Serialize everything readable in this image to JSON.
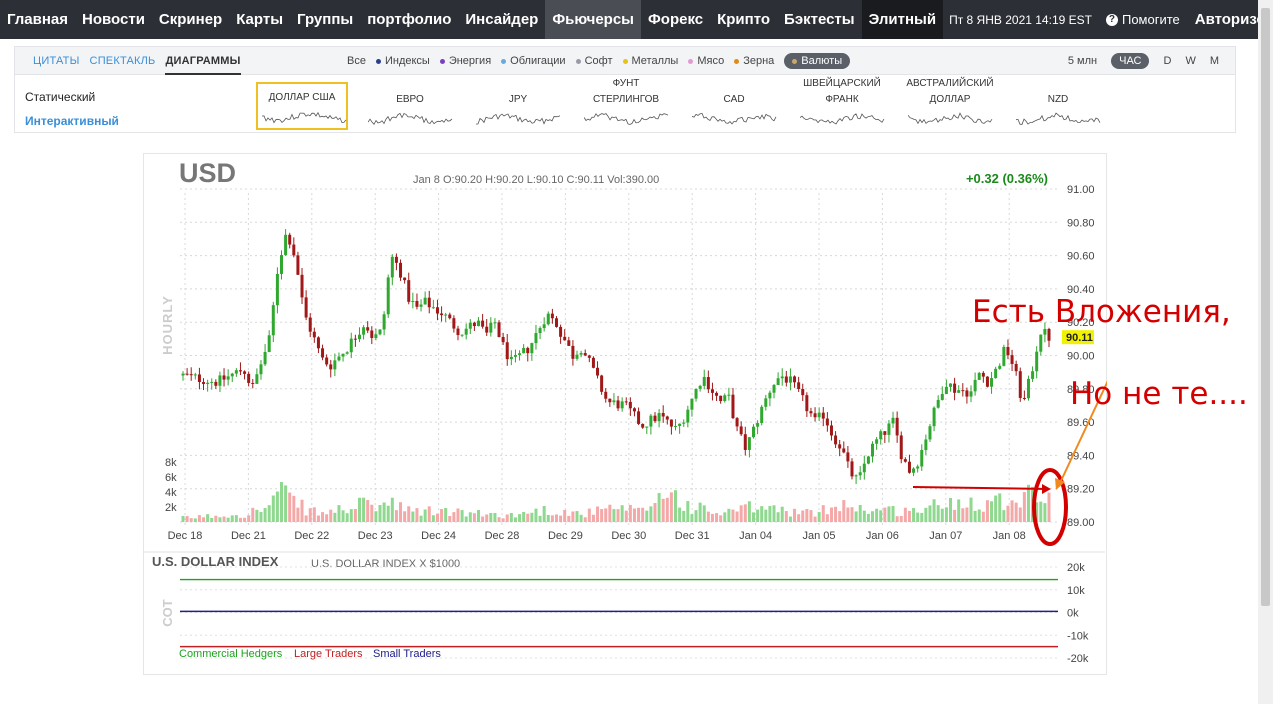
{
  "nav": {
    "items": [
      {
        "label": "Главная",
        "name": "nav-home"
      },
      {
        "label": "Новости",
        "name": "nav-news"
      },
      {
        "label": "Скринер",
        "name": "nav-screener"
      },
      {
        "label": "Карты",
        "name": "nav-maps"
      },
      {
        "label": "Группы",
        "name": "nav-groups"
      },
      {
        "label": "портфолио",
        "name": "nav-portfolio"
      },
      {
        "label": "Инсайдер",
        "name": "nav-insider"
      },
      {
        "label": "Фьючерсы",
        "name": "nav-futures"
      },
      {
        "label": "Форекс",
        "name": "nav-forex"
      },
      {
        "label": "Крипто",
        "name": "nav-crypto"
      },
      {
        "label": "Бэктесты",
        "name": "nav-backtests"
      },
      {
        "label": "Элитный",
        "name": "nav-elite"
      }
    ],
    "date": "Пт 8 ЯНВ 2021 14:19 EST",
    "help": "Помогите",
    "auth": "Авторизовать"
  },
  "panel": {
    "tabs": [
      "ЦИТАТЫ",
      "СПЕКТАКЛЬ",
      "ДИАГРАММЫ"
    ],
    "categories": [
      {
        "label": "Все",
        "dot": ""
      },
      {
        "label": "Индексы",
        "dot": "#2b3f8c"
      },
      {
        "label": "Энергия",
        "dot": "#7a3fc2"
      },
      {
        "label": "Облигации",
        "dot": "#6aa9e0"
      },
      {
        "label": "Софт",
        "dot": "#9a9aa8"
      },
      {
        "label": "Металлы",
        "dot": "#e6c21a"
      },
      {
        "label": "Мясо",
        "dot": "#e29ad0"
      },
      {
        "label": "Зерна",
        "dot": "#e08a1a"
      },
      {
        "label": "Валюты",
        "dot": "#9a7a3a"
      }
    ],
    "timeframes": [
      "5 млн",
      "ЧАС",
      "D",
      "W",
      "M"
    ],
    "links": {
      "static": "Статический",
      "interactive": "Интерактивный"
    },
    "thumbnails": [
      "ДОЛЛАР США",
      "ЕВРО",
      "JPY",
      "ФУНТ СТЕРЛИНГОВ",
      "CAD",
      "ШВЕЙЦАРСКИЙ ФРАНК",
      "АВСТРАЛИЙСКИЙ ДОЛЛАР",
      "NZD"
    ]
  },
  "chart": {
    "symbol": "USD",
    "ohlc": "Jan 8     O:90.20  H:90.20  L:90.10  C:90.11        Vol:390.00",
    "change": "+0.32 (0.36%)",
    "side_label": "HOURLY",
    "last_price": "90.11",
    "cot_title": "U.S. DOLLAR INDEX",
    "cot_subtitle": "U.S. DOLLAR INDEX X $1000",
    "cot_side_label": "COT",
    "legend": [
      "Commercial Hedgers",
      "Large Traders",
      "Small Traders"
    ]
  },
  "chart_data": {
    "type": "candlestick",
    "title": "USD",
    "timeframe": "hourly",
    "x_ticks": [
      "Dec 18",
      "Dec 21",
      "Dec 22",
      "Dec 23",
      "Dec 24",
      "Dec 28",
      "Dec 29",
      "Dec 30",
      "Dec 31",
      "Jan 04",
      "Jan 05",
      "Jan 06",
      "Jan 07",
      "Jan 08"
    ],
    "y_ticks": [
      "91.00",
      "90.80",
      "90.60",
      "90.40",
      "90.20",
      "90.00",
      "89.80",
      "89.60",
      "89.40",
      "89.20",
      "89.00"
    ],
    "ylim": [
      89.0,
      91.0
    ],
    "volume_ticks": [
      "8k",
      "6k",
      "4k",
      "2k"
    ],
    "last_ohlc": {
      "date": "Jan 8",
      "open": 90.2,
      "high": 90.2,
      "low": 90.1,
      "close": 90.11,
      "volume": 390.0
    },
    "change": "+0.32 (0.36%)",
    "price_path": [
      [
        0,
        89.88
      ],
      [
        4,
        89.84
      ],
      [
        7,
        89.92
      ],
      [
        8,
        89.8
      ],
      [
        10,
        90.1
      ],
      [
        11,
        90.55
      ],
      [
        12,
        90.75
      ],
      [
        13,
        90.58
      ],
      [
        14,
        90.25
      ],
      [
        15,
        90.12
      ],
      [
        16,
        89.98
      ],
      [
        17,
        89.94
      ],
      [
        19,
        90.05
      ],
      [
        21,
        90.2
      ],
      [
        22,
        90.1
      ],
      [
        23,
        90.15
      ],
      [
        24,
        90.6
      ],
      [
        25,
        90.52
      ],
      [
        26,
        90.35
      ],
      [
        27,
        90.28
      ],
      [
        28,
        90.32
      ],
      [
        30,
        90.25
      ],
      [
        32,
        90.14
      ],
      [
        34,
        90.2
      ],
      [
        35,
        90.12
      ],
      [
        36,
        90.2
      ],
      [
        37,
        90.05
      ],
      [
        38,
        89.95
      ],
      [
        40,
        90.05
      ],
      [
        42,
        90.25
      ],
      [
        43,
        90.2
      ],
      [
        44,
        90.1
      ],
      [
        45,
        90.0
      ],
      [
        46,
        90.05
      ],
      [
        47,
        89.95
      ],
      [
        49,
        89.72
      ],
      [
        51,
        89.7
      ],
      [
        53,
        89.58
      ],
      [
        55,
        89.64
      ],
      [
        57,
        89.55
      ],
      [
        58,
        89.65
      ],
      [
        60,
        89.88
      ],
      [
        62,
        89.72
      ],
      [
        63,
        89.75
      ],
      [
        64,
        89.55
      ],
      [
        65,
        89.44
      ],
      [
        67,
        89.7
      ],
      [
        68,
        89.82
      ],
      [
        69,
        89.88
      ],
      [
        70,
        89.85
      ],
      [
        71,
        89.78
      ],
      [
        73,
        89.6
      ],
      [
        74,
        89.65
      ],
      [
        75,
        89.52
      ],
      [
        76,
        89.45
      ],
      [
        77,
        89.3
      ],
      [
        78,
        89.24
      ],
      [
        79,
        89.4
      ],
      [
        80,
        89.48
      ],
      [
        82,
        89.6
      ],
      [
        83,
        89.4
      ],
      [
        84,
        89.3
      ],
      [
        85,
        89.38
      ],
      [
        86,
        89.55
      ],
      [
        87,
        89.7
      ],
      [
        88,
        89.85
      ],
      [
        89,
        89.8
      ],
      [
        91,
        89.78
      ],
      [
        92,
        89.9
      ],
      [
        93,
        89.84
      ],
      [
        94,
        89.92
      ],
      [
        95,
        90.05
      ],
      [
        96,
        89.92
      ],
      [
        97,
        89.7
      ],
      [
        98,
        89.9
      ],
      [
        99,
        90.15
      ],
      [
        100,
        90.11
      ]
    ],
    "volume_profile": [
      [
        0,
        0.6
      ],
      [
        7,
        1.2
      ],
      [
        10,
        2.2
      ],
      [
        11,
        4.8
      ],
      [
        12,
        3.6
      ],
      [
        14,
        2.0
      ],
      [
        16,
        1.2
      ],
      [
        20,
        2.4
      ],
      [
        24,
        2.6
      ],
      [
        26,
        1.6
      ],
      [
        30,
        1.6
      ],
      [
        34,
        1.2
      ],
      [
        38,
        1.0
      ],
      [
        42,
        1.8
      ],
      [
        46,
        1.2
      ],
      [
        50,
        2.0
      ],
      [
        53,
        1.5
      ],
      [
        56,
        4.8
      ],
      [
        58,
        2.5
      ],
      [
        62,
        1.2
      ],
      [
        66,
        2.2
      ],
      [
        70,
        1.6
      ],
      [
        73,
        1.2
      ],
      [
        76,
        3.0
      ],
      [
        78,
        2.0
      ],
      [
        80,
        1.8
      ],
      [
        84,
        1.6
      ],
      [
        86,
        2.2
      ],
      [
        88,
        2.6
      ],
      [
        90,
        3.2
      ],
      [
        93,
        3.0
      ],
      [
        96,
        3.6
      ],
      [
        98,
        4.6
      ],
      [
        100,
        3.0
      ]
    ],
    "cot": {
      "title": "U.S. DOLLAR INDEX",
      "subtitle": "U.S. DOLLAR INDEX X $1000",
      "y_ticks": [
        "20k",
        "10k",
        "0k",
        "-10k",
        "-20k"
      ],
      "series": [
        {
          "name": "Commercial Hedgers",
          "color": "#1fa21f",
          "value": 14500
        },
        {
          "name": "Large Traders",
          "color": "#c02020",
          "value": -15000
        },
        {
          "name": "Small Traders",
          "color": "#20208a",
          "value": 500
        }
      ]
    }
  },
  "annotation": {
    "line1": "Есть Вложения,",
    "line2": "Но не те...."
  },
  "colors": {
    "nav_bg": "#2c2f35",
    "accent_blue": "#3a8fd8",
    "up_candle": "#2fa82f",
    "down_candle": "#a01818",
    "volume_up": "#8fd88f",
    "volume_down": "#f4a8a8",
    "change_green": "#1a8a1a",
    "price_badge": "#f2f200",
    "annotation_red": "#d40000",
    "arrow_orange": "#f08a1e"
  }
}
